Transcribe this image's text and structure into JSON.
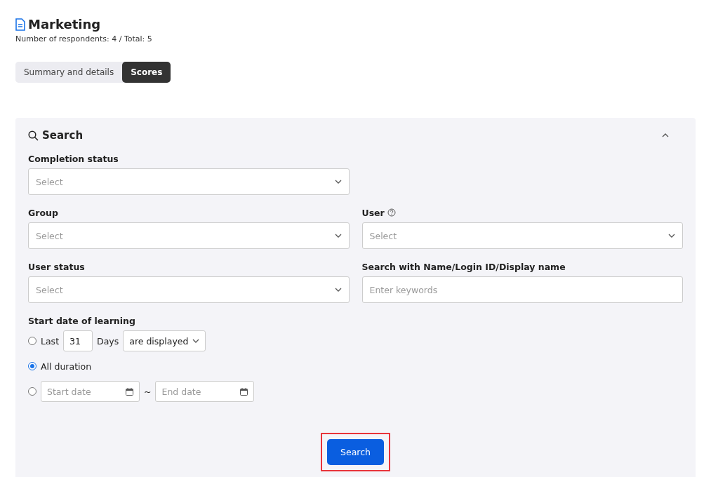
{
  "header": {
    "title": "Marketing",
    "subtitle": "Number of respondents: 4 / Total: 5"
  },
  "tabs": [
    {
      "label": "Summary and details",
      "selected": false
    },
    {
      "label": "Scores",
      "selected": true
    }
  ],
  "search_panel": {
    "title": "Search",
    "expanded": true,
    "rows": [
      [
        {
          "label": "Completion status",
          "kind": "select",
          "placeholder": "Select",
          "help": false
        }
      ],
      [
        {
          "label": "Group",
          "kind": "select",
          "placeholder": "Select",
          "help": false
        },
        {
          "label": "User",
          "kind": "select",
          "placeholder": "Select",
          "help": true
        }
      ],
      [
        {
          "label": "User status",
          "kind": "select",
          "placeholder": "Select",
          "help": false
        },
        {
          "label": "Search with Name/Login ID/Display name",
          "kind": "text",
          "placeholder": "Enter keywords",
          "help": false
        }
      ]
    ],
    "start_date": {
      "label": "Start date of learning",
      "options": [
        {
          "kind": "last_days",
          "selected": false,
          "prefix": "Last",
          "value": "31",
          "unit": "Days",
          "mode": "are displayed"
        },
        {
          "kind": "all",
          "selected": true,
          "label": "All duration"
        },
        {
          "kind": "range",
          "selected": false,
          "start_placeholder": "Start date",
          "separator": "~",
          "end_placeholder": "End date"
        }
      ]
    },
    "button": {
      "label": "Search",
      "highlighted": true
    }
  }
}
